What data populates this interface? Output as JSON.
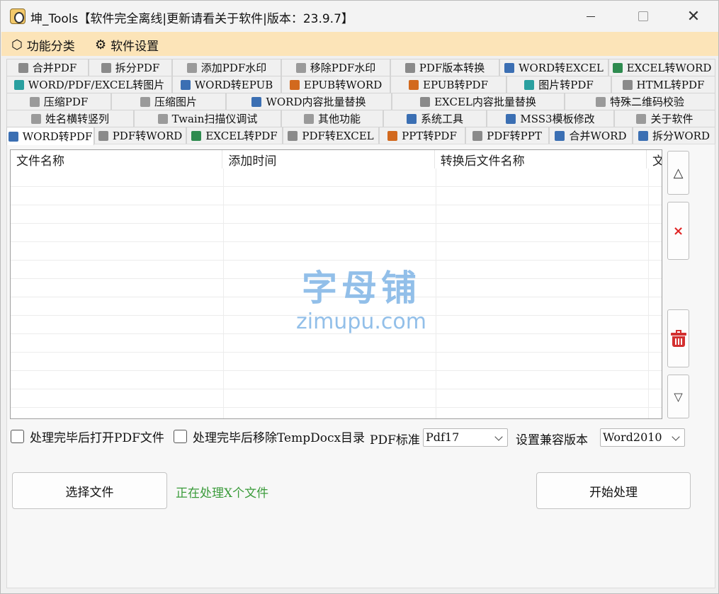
{
  "window": {
    "title": "坤_Tools【软件完全离线|更新请看关于软件|版本：23.9.7】",
    "close_glyph": "✕"
  },
  "menu": {
    "items": [
      {
        "label": "功能分类",
        "icon": "cube-icon",
        "glyph": "⬡"
      },
      {
        "label": "软件设置",
        "icon": "gear-icon",
        "glyph": "⚙"
      }
    ]
  },
  "tabs": {
    "row1": [
      "合并PDF",
      "拆分PDF",
      "添加PDF水印",
      "移除PDF水印",
      "PDF版本转换",
      "WORD转EXCEL",
      "EXCEL转WORD"
    ],
    "row2": [
      "WORD/PDF/EXCEL转图片",
      "WORD转EPUB",
      "EPUB转WORD",
      "EPUB转PDF",
      "图片转PDF",
      "HTML转PDF"
    ],
    "row3": [
      "压缩PDF",
      "压缩图片",
      "WORD内容批量替换",
      "EXCEL内容批量替换",
      "特殊二维码校验"
    ],
    "row4": [
      "姓名横转竖列",
      "Twain扫描仪调试",
      "其他功能",
      "系统工具",
      "MSS3模板修改",
      "关于软件"
    ],
    "row5": [
      "WORD转PDF",
      "PDF转WORD",
      "EXCEL转PDF",
      "PDF转EXCEL",
      "PPT转PDF",
      "PDF转PPT",
      "合并WORD",
      "拆分WORD"
    ],
    "active": "WORD转PDF"
  },
  "grid": {
    "columns": [
      "文件名称",
      "添加时间",
      "转换后文件名称",
      "文"
    ],
    "rows": []
  },
  "watermark": {
    "cn": "字母铺",
    "en": "zimupu.com"
  },
  "side_buttons": {
    "up": "△",
    "delete": "×",
    "down": "▽"
  },
  "options": {
    "open_pdf_after": {
      "label": "处理完毕后打开PDF文件",
      "checked": false
    },
    "remove_temp_after": {
      "label": "处理完毕后移除TempDocx目录",
      "checked": false
    },
    "pdf_standard_label": "PDF标准",
    "pdf_standard_value": "Pdf17",
    "compat_label": "设置兼容版本",
    "compat_value": "Word2010"
  },
  "actions": {
    "choose_file": "选择文件",
    "status": "正在处理X个文件",
    "start": "开始处理"
  },
  "colors": {
    "menubar": "#fce4b8",
    "status_text": "#3a9b3a",
    "delete_red": "#e02424"
  }
}
